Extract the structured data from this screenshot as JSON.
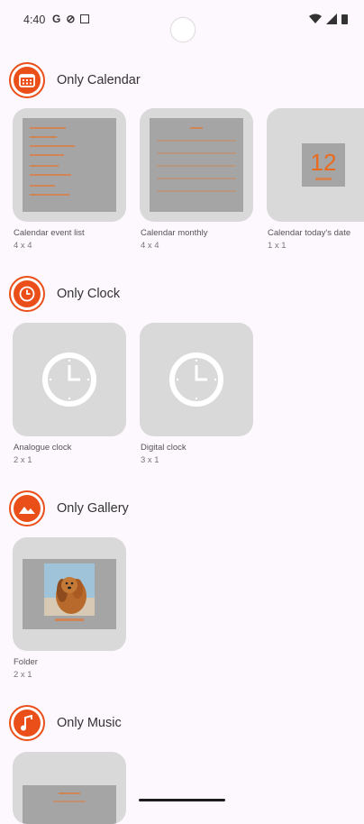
{
  "status_bar": {
    "time": "4:40",
    "icons": [
      "google-icon",
      "do-not-disturb-icon",
      "notification-icon"
    ]
  },
  "sections": {
    "calendar": {
      "title": "Only Calendar",
      "widgets": [
        {
          "name": "Calendar event list",
          "size": "4 x 4"
        },
        {
          "name": "Calendar monthly",
          "size": "4 x 4"
        },
        {
          "name": "Calendar today's date",
          "size": "1 x 1",
          "day": "12"
        }
      ]
    },
    "clock": {
      "title": "Only Clock",
      "widgets": [
        {
          "name": "Analogue clock",
          "size": "2 x 1"
        },
        {
          "name": "Digital clock",
          "size": "3 x 1"
        }
      ]
    },
    "gallery": {
      "title": "Only Gallery",
      "widgets": [
        {
          "name": "Folder",
          "size": "2 x 1"
        }
      ]
    },
    "music": {
      "title": "Only Music",
      "widgets": []
    }
  },
  "colors": {
    "accent": "#ea4f1a",
    "card": "#d9d9d9",
    "preview": "#a5a5a5"
  }
}
